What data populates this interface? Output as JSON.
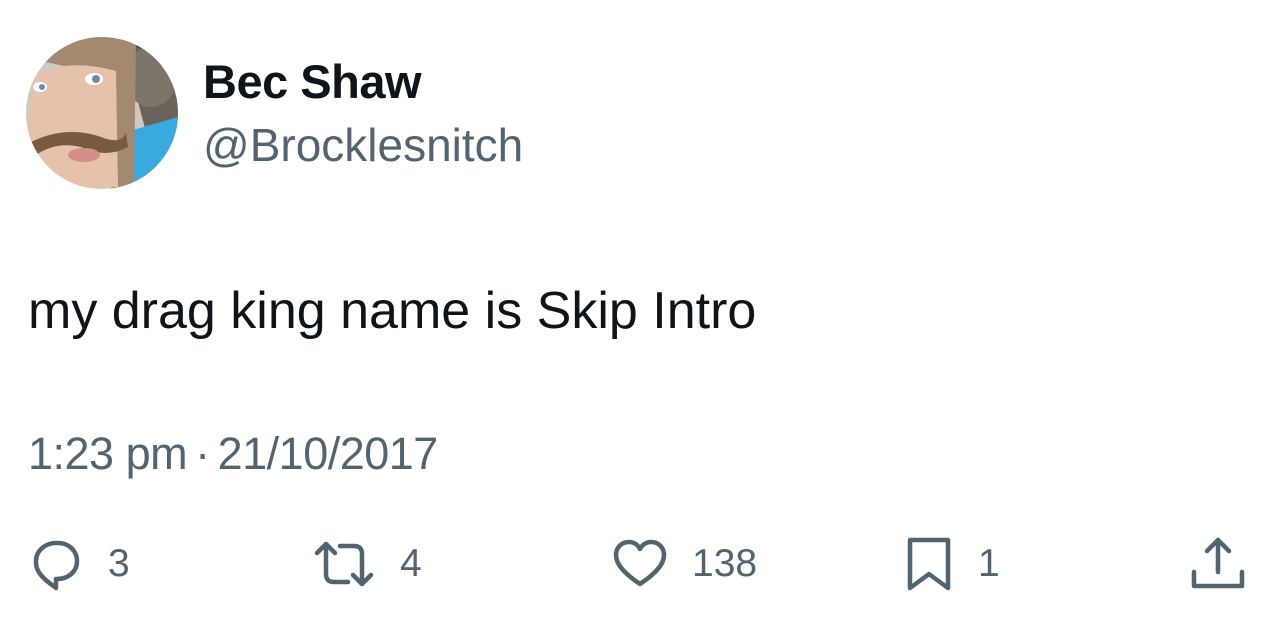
{
  "tweet": {
    "author": {
      "display_name": "Bec Shaw",
      "handle": "@Brocklesnitch",
      "avatar": "profile-photo"
    },
    "text": "my drag king name is Skip Intro",
    "time": "1:23 pm",
    "separator": "·",
    "date": "21/10/2017",
    "actions": {
      "reply": {
        "icon": "reply-icon",
        "count": "3"
      },
      "retweet": {
        "icon": "retweet-icon",
        "count": "4"
      },
      "like": {
        "icon": "heart-icon",
        "count": "138"
      },
      "bookmark": {
        "icon": "bookmark-icon",
        "count": "1"
      },
      "share": {
        "icon": "share-icon"
      }
    },
    "colors": {
      "primary_text": "#0f1419",
      "secondary_text": "#536471",
      "background": "#ffffff"
    }
  }
}
